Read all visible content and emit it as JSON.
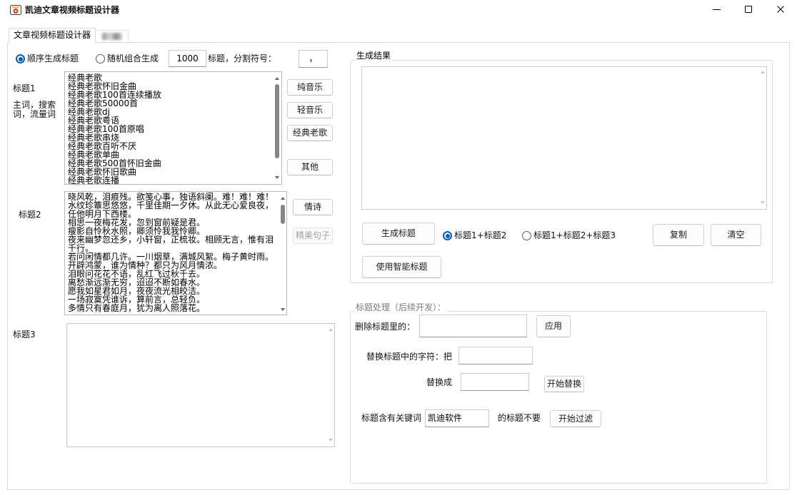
{
  "window": {
    "title": "凯迪文章视频标题设计器",
    "icon": "app-icon",
    "controls": {
      "minimize": "minimize-icon",
      "maximize": "maximize-icon",
      "close": "close-icon"
    }
  },
  "tabs": [
    {
      "label": "文章视频标题设计器",
      "selected": true
    }
  ],
  "mode": {
    "sequential": {
      "label": "顺序生成标题",
      "selected": true
    },
    "random": {
      "label": "随机组合生成",
      "selected": false
    },
    "count": "1000",
    "separator_label": "标题，分割符号：",
    "separator": "，"
  },
  "title1": {
    "label": "标题1",
    "hint": "主词，搜索词，流量词",
    "lines": [
      "经典老歌",
      "经典老歌怀旧金曲",
      "经典老歌100首连续播放",
      "经典老歌50000首",
      "经典老歌dj",
      "经典老歌粤语",
      "经典老歌100首原唱",
      "经典老歌串烧",
      "经典老歌百听不厌",
      "经典老歌单曲",
      "经典老歌500首怀旧金曲",
      "经典老歌怀旧歌曲",
      "经典老歌连播"
    ],
    "buttons": [
      {
        "label": "纯音乐"
      },
      {
        "label": "轻音乐"
      },
      {
        "label": "经典老歌"
      },
      {
        "label": "其他"
      }
    ]
  },
  "title2": {
    "label": "标题2",
    "lines": [
      "晓风乾，泪痕残。欲笺心事，独语斜阑。难！难！难！",
      "水纹珍簟思悠悠，千里佳期一夕休。从此无心爱良夜，",
      "任他明月下西楼。",
      "相思一夜梅花发，忽到窗前疑是君。",
      "瘦影自怜秋水照，卿须怜我我怜卿。",
      "夜来幽梦忽还乡，小轩窗，正梳妆。相顾无言，惟有泪",
      "千行。",
      "若问闲情都几许。一川烟草，满城风絮。梅子黄时雨。",
      "开辟鸿蒙，谁为情种？都只为风月情浓。",
      "泪眼问花花不语，乱红飞过秋千去。",
      "离愁渐远渐无穷，迢迢不断如春水。",
      "愿我如星君如月，夜夜流光相皎洁。",
      "一场寂寞凭谁诉，算前言，总轻负。",
      "多情只有春庭月，犹为离人照落花。"
    ],
    "buttons": [
      {
        "label": "情诗",
        "disabled": false
      },
      {
        "label": "精美句子",
        "disabled": true
      }
    ]
  },
  "title3": {
    "label": "标题3",
    "text": ""
  },
  "result": {
    "group_label": "生成结果",
    "text": "",
    "generate_button": "生成标题",
    "combos": [
      {
        "label": "标题1+标题2",
        "selected": true
      },
      {
        "label": "标题1+标题2+标题3",
        "selected": false
      }
    ],
    "copy_button": "复制",
    "clear_button": "清空",
    "smart_button": "使用智能标题"
  },
  "processing": {
    "group_label": "标题处理（后续开发）：",
    "delete": {
      "label": "删除标题里的：",
      "value": "",
      "button": "应用"
    },
    "replace": {
      "from_label": "替换标题中的字符：把",
      "from_value": "",
      "to_label": "替换成",
      "to_value": "",
      "button": "开始替换"
    },
    "filter": {
      "label": "标题含有关键词",
      "value": "凯迪软件",
      "suffix": "的标题不要",
      "button": "开始过滤"
    }
  },
  "colors": {
    "accent": "#005fb8",
    "button_bg": "#fdfdfd",
    "button_border": "#d0d0d0",
    "disabled_text": "#a0a0a0",
    "muted_label": "#7a7a7a"
  }
}
